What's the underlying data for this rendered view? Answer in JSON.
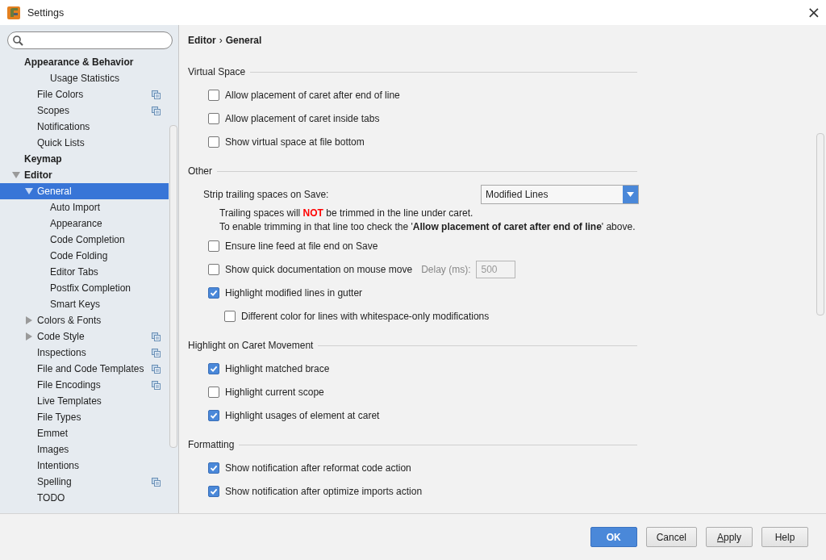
{
  "window": {
    "title": "Settings",
    "close": "×"
  },
  "sidebar": {
    "items": [
      {
        "label": "Appearance & Behavior",
        "children": [
          {
            "children": [
              {
                "label": "Usage Statistics"
              }
            ]
          },
          {
            "label": "File Colors",
            "project_level": true
          },
          {
            "label": "Scopes",
            "project_level": true
          },
          {
            "label": "Notifications"
          },
          {
            "label": "Quick Lists"
          }
        ]
      },
      {
        "label": "Keymap"
      },
      {
        "label": "Editor",
        "expanded": true,
        "children": [
          {
            "label": "General",
            "expanded": true,
            "selected": true,
            "children": [
              {
                "label": "Auto Import"
              },
              {
                "label": "Appearance"
              },
              {
                "label": "Code Completion"
              },
              {
                "label": "Code Folding"
              },
              {
                "label": "Editor Tabs"
              },
              {
                "label": "Postfix Completion"
              },
              {
                "label": "Smart Keys"
              }
            ]
          },
          {
            "label": "Colors & Fonts",
            "expanded": false
          },
          {
            "label": "Code Style",
            "expanded": false,
            "project_level": true
          },
          {
            "label": "Inspections",
            "project_level": true
          },
          {
            "label": "File and Code Templates",
            "project_level": true
          },
          {
            "label": "File Encodings",
            "project_level": true
          },
          {
            "label": "Live Templates"
          },
          {
            "label": "File Types"
          },
          {
            "label": "Emmet"
          },
          {
            "label": "Images"
          },
          {
            "label": "Intentions"
          },
          {
            "label": "Spelling",
            "project_level": true
          },
          {
            "label": "TODO"
          }
        ]
      }
    ]
  },
  "breadcrumb": [
    "Editor",
    "General"
  ],
  "breadcrumb_separator": "›",
  "sections": [
    {
      "title": "Virtual Space",
      "items": [
        {
          "kind": "checkbox",
          "label": "Allow placement of caret after end of line",
          "checked": false
        },
        {
          "kind": "checkbox",
          "label": "Allow placement of caret inside tabs",
          "checked": false
        },
        {
          "kind": "checkbox",
          "label": "Show virtual space at file bottom",
          "checked": false
        }
      ]
    },
    {
      "title": "Other",
      "items": [
        {
          "kind": "dropdown",
          "label": "Strip trailing spaces on Save:",
          "value": "Modified Lines"
        },
        {
          "kind": "warning",
          "text": "Trailing spaces will **NOT** be trimmed in the line under caret."
        },
        {
          "kind": "hint",
          "text": "To enable trimming in that line too check the '**Allow placement of caret after end of line**' above."
        },
        {
          "kind": "checkbox",
          "label": "Ensure line feed at file end on Save",
          "checked": false
        },
        {
          "kind": "checkbox",
          "label": "Show quick documentation on mouse move",
          "checked": false,
          "field_label": "Delay (ms):",
          "field_value": "500",
          "field_disabled": true
        },
        {
          "kind": "checkbox",
          "label": "Highlight modified lines in gutter",
          "checked": true,
          "children": [
            {
              "kind": "checkbox",
              "label": "Different color for lines with whitespace-only modifications",
              "checked": false
            }
          ]
        }
      ]
    },
    {
      "title": "Highlight on Caret Movement",
      "items": [
        {
          "kind": "checkbox",
          "label": "Highlight matched brace",
          "checked": true
        },
        {
          "kind": "checkbox",
          "label": "Highlight current scope",
          "checked": false
        },
        {
          "kind": "checkbox",
          "label": "Highlight usages of element at caret",
          "checked": true
        }
      ]
    },
    {
      "title": "Formatting",
      "items": [
        {
          "kind": "checkbox",
          "label": "Show notification after reformat code action",
          "checked": true
        },
        {
          "kind": "checkbox",
          "label": "Show notification after optimize imports action",
          "checked": true
        }
      ]
    }
  ],
  "buttons": [
    {
      "label": "OK",
      "default": true
    },
    {
      "label": "Cancel",
      "default": false
    },
    {
      "label": "Apply",
      "default": false,
      "mnemonic_underlined": true
    },
    {
      "label": "Help",
      "default": false
    }
  ]
}
